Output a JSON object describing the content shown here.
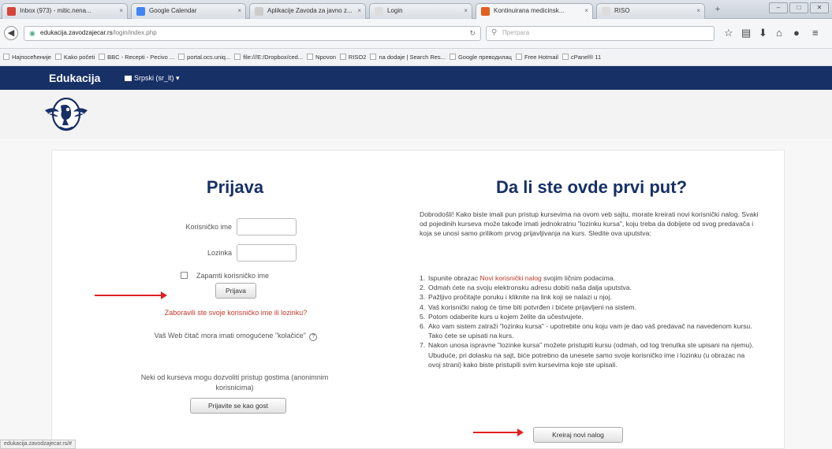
{
  "browser": {
    "tabs": [
      {
        "label": "Inbox (973) - mitic.nena...",
        "active": false,
        "favicon_color": "#d44638"
      },
      {
        "label": "Google Calendar",
        "active": false,
        "favicon_color": "#4285f4"
      },
      {
        "label": "Aplikacije Zavoda za javno z...",
        "active": false,
        "favicon_color": "#cccccc"
      },
      {
        "label": "Login",
        "active": false,
        "favicon_color": "#dddddd"
      },
      {
        "label": "Kontinuirana medicinsk...",
        "active": true,
        "favicon_color": "#e06020"
      },
      {
        "label": "RISO",
        "active": false,
        "favicon_color": "#dddddd"
      }
    ],
    "new_tab": "+",
    "url_domain": "edukacija.zavodzajecar.rs",
    "url_path": "/login/index.php",
    "search_placeholder": "Претрага",
    "bookmarks": [
      "Најпосећеније",
      "Kako početi",
      "BBC - Recepti - Pecivo ...",
      "portal.ocs.uniq...",
      "file:///E:/Dropbox/ced...",
      "Npovon",
      "RISO2",
      "na dodaje | Search Res...",
      "Google преводилац",
      "Free Hotmail",
      "cPanel® 11"
    ],
    "status_url": "edukacija.zavodzajecar.rs/#"
  },
  "site": {
    "brand": "Edukacija",
    "language": "Srpski (sr_lt) ▾",
    "colors": {
      "header": "#173066",
      "title": "#173066",
      "link": "#c0392b",
      "arrow": "#e02020"
    }
  },
  "login": {
    "title": "Prijava",
    "username_label": "Korisničko ime",
    "username_value": "",
    "password_label": "Lozinka",
    "password_value": "",
    "remember_label": "Zapamti korisničko ime",
    "remember_checked": false,
    "login_button": "Prijava",
    "forgot_link": "Zaboravili ste svoje korisničko ime ili lozinku?",
    "cookies_note": "Vaš Web čitač mora imati omogućene \"kolačiće\"",
    "help_icon": "?",
    "guest_text": "Neki od kurseva mogu dozvoliti pristup gostima (anonimnim korisnicima)",
    "guest_button": "Prijavite se kao gost"
  },
  "signup": {
    "title": "Da li ste ovde prvi put?",
    "intro": "Dobrodošli! Kako biste imali pun pristup kursevima na ovom veb sajtu, morate kreirati novi korisnički nalog. Svaki od pojedinih kurseva može takođe imati jednokratnu \"lozinku kursa\", koju treba da dobijete od svog predavača i koja se unosi samo prilikom prvog prijavljivanja na kurs. Sledite ova uputstva:",
    "steps": [
      {
        "num": "1.",
        "before": "Ispunite obrazac ",
        "link": "Novi korisnički nalog",
        "after": " svojim ličnim podacima."
      },
      {
        "num": "2.",
        "before": "Odmah ćete na svoju elektronsku adresu dobiti naša dalja uputstva.",
        "link": "",
        "after": ""
      },
      {
        "num": "3.",
        "before": "Pažljivo pročitajte poruku i kliknite na link koji se nalazi u njoj.",
        "link": "",
        "after": ""
      },
      {
        "num": "4.",
        "before": "Vaš korisnički nalog će time biti potvrđen i bićete prijavljeni na sistem.",
        "link": "",
        "after": ""
      },
      {
        "num": "5.",
        "before": "Potom odaberite kurs u kojem želite da učestvujete.",
        "link": "",
        "after": ""
      },
      {
        "num": "6.",
        "before": "Ako vam sistem zatraži \"lozinku kursa\" - upotrebite onu koju vam je dao vaš predavač na navedenom kursu. Tako ćete se upisati na kurs.",
        "link": "",
        "after": ""
      },
      {
        "num": "7.",
        "before": "Nakon unosa ispravne \"lozinke kursa\" možete pristupiti kursu (odmah, od tog trenutka ste upisani na njemu). Ubuduće, pri dolasku na sajt, biće potrebno da unesete samo svoje korisničko ime i lozinku (u obrazac na ovoj strani) kako biste pristupili svim kursevima koje ste upisali.",
        "link": "",
        "after": ""
      }
    ],
    "create_button": "Kreiraj novi nalog"
  }
}
